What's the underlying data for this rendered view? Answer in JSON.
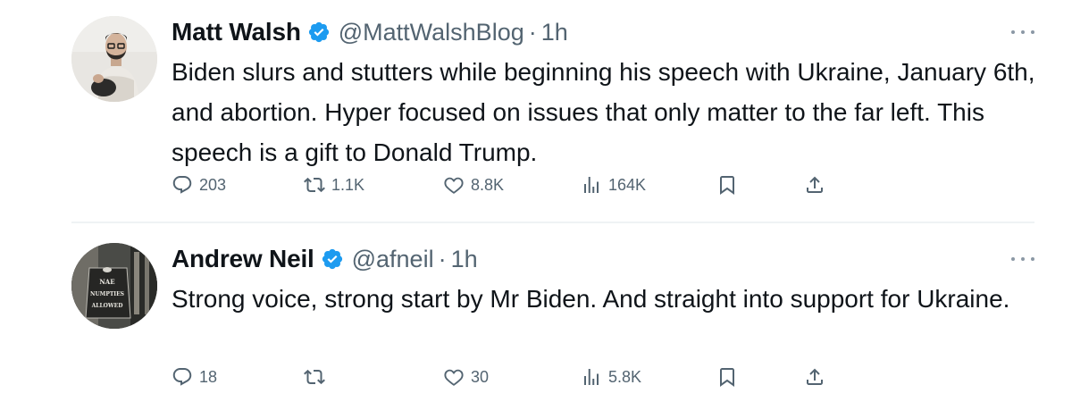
{
  "tweets": [
    {
      "author_name": "Matt Walsh",
      "handle": "@MattWalshBlog",
      "separator": "·",
      "time": "1h",
      "text": "Biden slurs and stutters while beginning his speech with Ukraine, January 6th, and abortion. Hyper focused on issues that only matter to the far left. This speech is a gift to Donald Trump.",
      "replies": "203",
      "retweets": "1.1K",
      "likes": "8.8K",
      "views": "164K"
    },
    {
      "author_name": "Andrew Neil",
      "handle": "@afneil",
      "separator": "·",
      "time": "1h",
      "text": "Strong voice, strong start by Mr Biden. And straight into support for Ukraine.",
      "replies": "18",
      "retweets": "",
      "likes": "30",
      "views": "5.8K",
      "avatar_sign_text": "NAE NUMPTIES ALLOWED"
    }
  ],
  "colors": {
    "verified_blue": "#1d9bf0",
    "secondary_text": "#536471",
    "primary_text": "#0f1419"
  },
  "icons": [
    "reply-icon",
    "retweet-icon",
    "like-icon",
    "views-icon",
    "bookmark-icon",
    "share-icon",
    "verified-badge-icon",
    "more-icon"
  ]
}
